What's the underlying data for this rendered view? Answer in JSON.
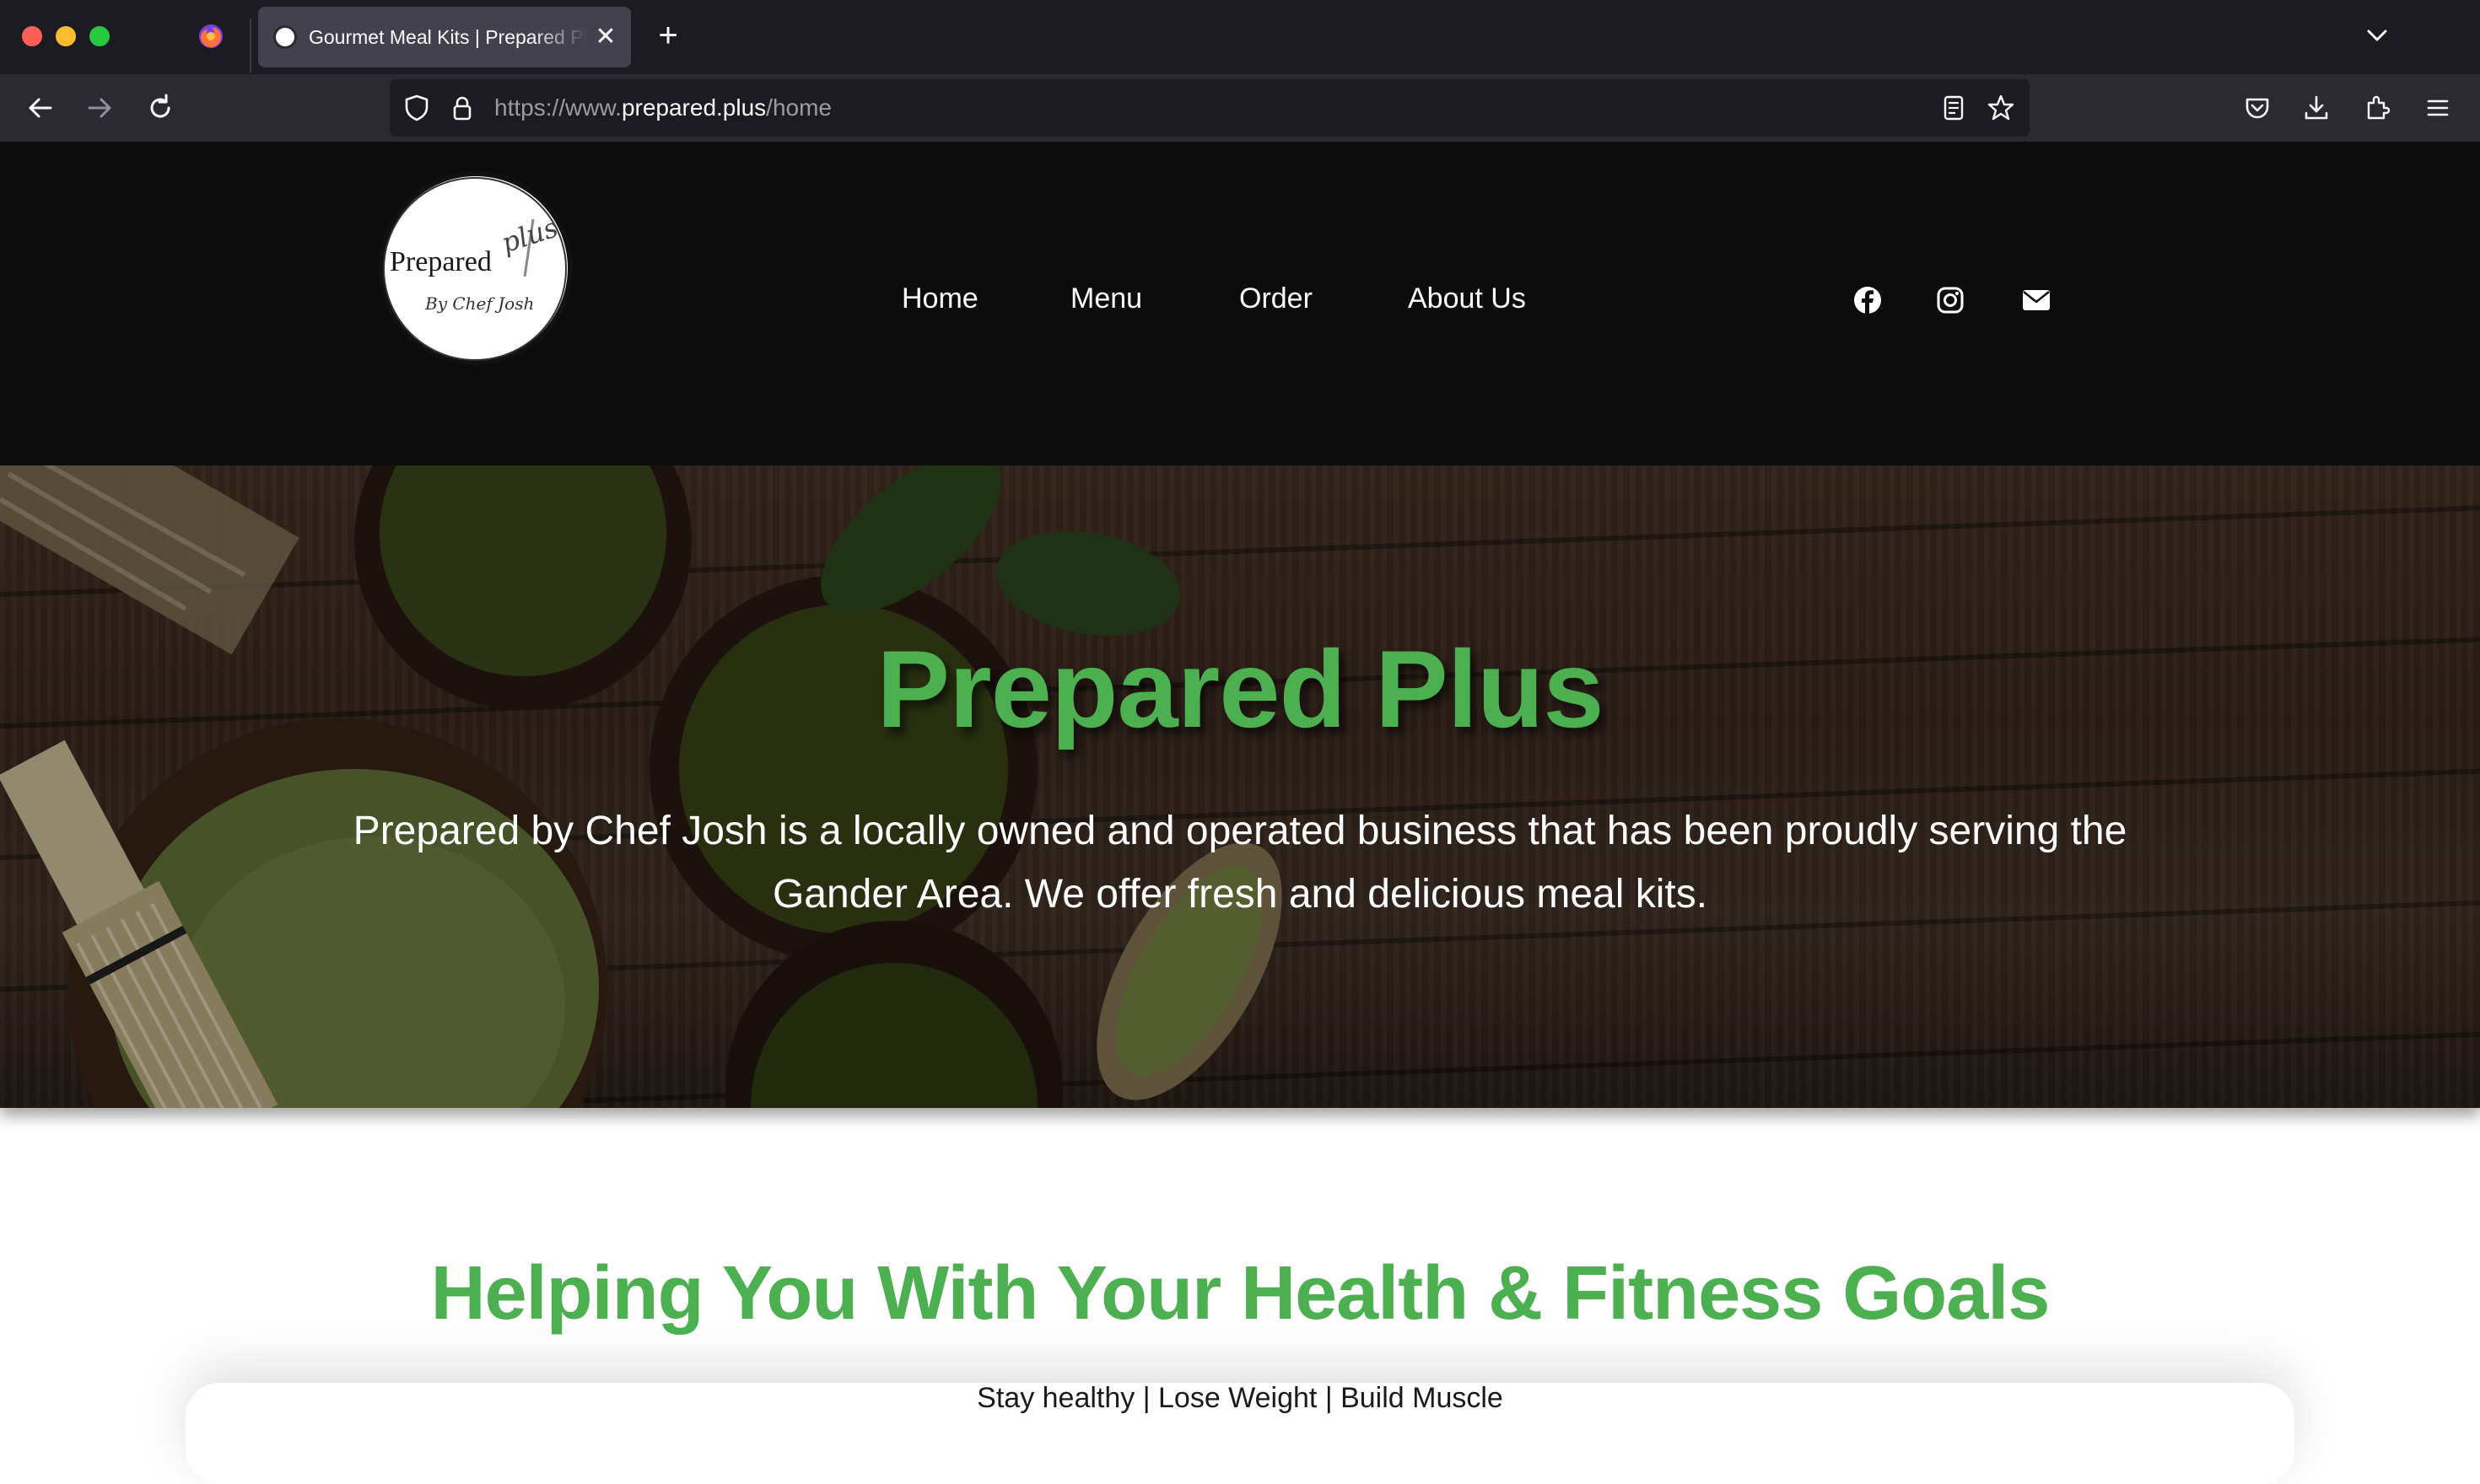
{
  "browser": {
    "tab_title": "Gourmet Meal Kits | Prepared Plus",
    "url_prefix": "https://www.",
    "url_host": "prepared.plus",
    "url_path": "/home",
    "close_glyph": "✕",
    "new_tab_glyph": "+"
  },
  "site": {
    "logo": {
      "name": "Prepared",
      "plus": "plus",
      "tagline": "By Chef Josh"
    },
    "nav": [
      "Home",
      "Menu",
      "Order",
      "About Us"
    ],
    "social_icons": [
      "facebook-icon",
      "instagram-icon",
      "envelope-icon"
    ]
  },
  "hero": {
    "title": "Prepared Plus",
    "text": "Prepared by Chef Josh is a locally owned and operated business that has been proudly serving the Gander Area. We offer fresh and delicious meal kits."
  },
  "section": {
    "title": "Helping You With Your Health & Fitness Goals",
    "subtitle": "Stay healthy | Lose Weight | Build Muscle"
  },
  "colors": {
    "accent_green": "#4caf50",
    "header_bg": "#0c0c0c",
    "chrome_bg": "#2b2a33"
  }
}
